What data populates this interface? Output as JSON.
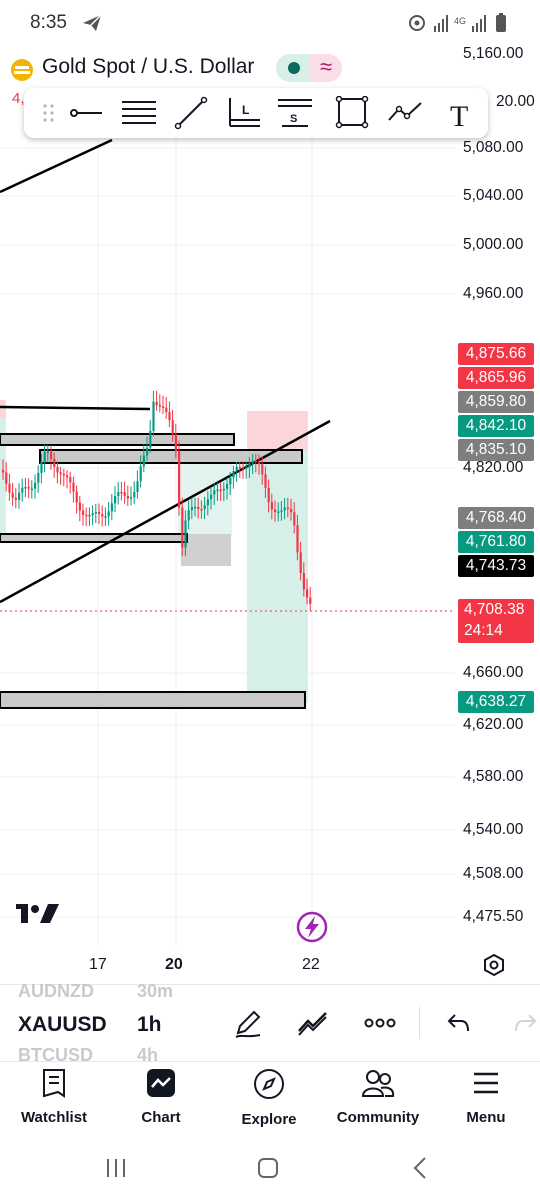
{
  "status_bar": {
    "time": "8:35",
    "network": "4G"
  },
  "header": {
    "symbol_title": "Gold Spot / U.S. Dollar",
    "partial_price": "4,",
    "partial_price_right": "20.00"
  },
  "drawing_toolbar": {
    "tools": [
      "drag-handle",
      "horizontal-ray",
      "parallel-channel",
      "trend-line",
      "long-position",
      "short-position",
      "rectangle",
      "path",
      "text"
    ],
    "long_label": "L",
    "short_label": "S",
    "text_label": "T"
  },
  "price_axis": {
    "labels": [
      "5,160.00",
      "5,080.00",
      "5,040.00",
      "5,000.00",
      "4,960.00",
      "4,820.00",
      "4,660.00",
      "4,620.00",
      "4,580.00",
      "4,540.00",
      "4,508.00",
      "4,475.50"
    ]
  },
  "price_tags": {
    "t1": "4,875.66",
    "t2": "4,865.96",
    "t3": "4,859.80",
    "t4": "4,842.10",
    "t5": "4,835.10",
    "t6": "4,768.40",
    "t7": "4,761.80",
    "t8": "4,743.73",
    "t9": "4,708.38",
    "t9_countdown": "24:14",
    "t10": "4,638.27"
  },
  "time_axis": {
    "labels": [
      "17",
      "20",
      "22"
    ]
  },
  "chart_bottom": {
    "logo": "tradingview-logo"
  },
  "symbol_switcher": {
    "prev_symbol": "AUDNZD",
    "prev_interval": "30m",
    "symbol": "XAUUSD",
    "interval": "1h",
    "next_symbol": "BTCUSD",
    "next_interval": "4h"
  },
  "bottom_nav": {
    "items": [
      {
        "label": "Watchlist",
        "icon": "watchlist-icon"
      },
      {
        "label": "Chart",
        "icon": "chart-icon"
      },
      {
        "label": "Explore",
        "icon": "compass-icon"
      },
      {
        "label": "Community",
        "icon": "community-icon"
      },
      {
        "label": "Menu",
        "icon": "menu-icon"
      }
    ]
  },
  "colors": {
    "up": "#089981",
    "down": "#f23645",
    "grey_tag": "#7e7e7e",
    "black_tag": "#000000",
    "tp_zone": "#d6efe9",
    "sl_zone": "#fbd5da",
    "purple": "#9c27b0"
  }
}
